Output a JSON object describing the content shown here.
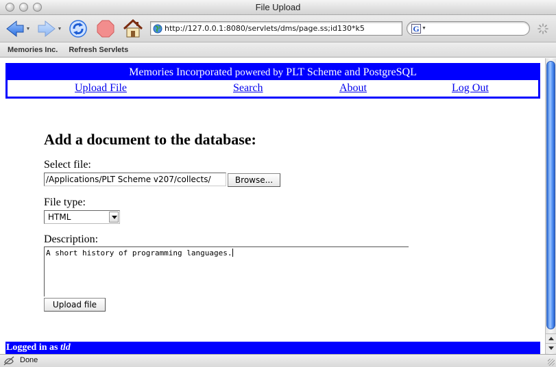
{
  "window": {
    "title": "File Upload"
  },
  "toolbar": {
    "url": "http://127.0.0.1:8080/servlets/dms/page.ss;id130*k5",
    "search_value": ""
  },
  "bookmarks": [
    "Memories Inc.",
    "Refresh Servlets"
  ],
  "banner": {
    "name": "Memories Incorporated",
    "powered_by": "powered by",
    "tech": "PLT Scheme and PostgreSQL"
  },
  "nav": [
    "Upload File",
    "Search",
    "About",
    "Log Out"
  ],
  "form": {
    "heading": "Add a document to the database:",
    "file_label": "Select file:",
    "file_value": "/Applications/PLT Scheme v207/collects/",
    "browse_label": "Browse...",
    "type_label": "File type:",
    "type_value": "HTML",
    "desc_label": "Description:",
    "desc_value": "A short history of programming languages.",
    "submit_label": "Upload file"
  },
  "footer": {
    "prefix": "Logged in as",
    "user": "tld"
  },
  "status": {
    "text": "Done"
  },
  "colors": {
    "banner": "#0000ff",
    "link": "#0000ee"
  }
}
